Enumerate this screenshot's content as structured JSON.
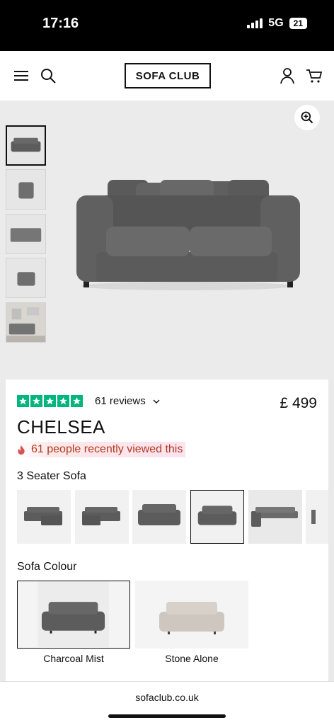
{
  "status_bar": {
    "time": "17:16",
    "network": "5G",
    "battery": "21"
  },
  "header": {
    "logo": "SOFA CLUB"
  },
  "product": {
    "rating_stars": 5,
    "reviews_label": "61 reviews",
    "price": "£ 499",
    "name": "CHELSEA",
    "recently_viewed": "61 people recently viewed this"
  },
  "seater": {
    "label": "3 Seater Sofa",
    "selected_index": 3,
    "option_count": 6
  },
  "colour": {
    "label": "Sofa Colour",
    "options": [
      {
        "name": "Charcoal Mist",
        "swatch": "#5c5c5c"
      },
      {
        "name": "Stone Alone",
        "swatch": "#cdc7c0"
      }
    ],
    "selected_index": 0
  },
  "browser": {
    "url": "sofaclub.co.uk"
  },
  "icons": {
    "menu": "hamburger-icon",
    "search": "search-icon",
    "account": "user-icon",
    "basket": "cart-icon",
    "zoom": "zoom-in-icon",
    "reviews_toggle": "chevron-down-icon",
    "viewed": "flame-icon"
  },
  "colors": {
    "trustpilot_green": "#00b67a",
    "sofa_charcoal": "#5c5c5c",
    "viewed_text": "#b23a1b"
  }
}
